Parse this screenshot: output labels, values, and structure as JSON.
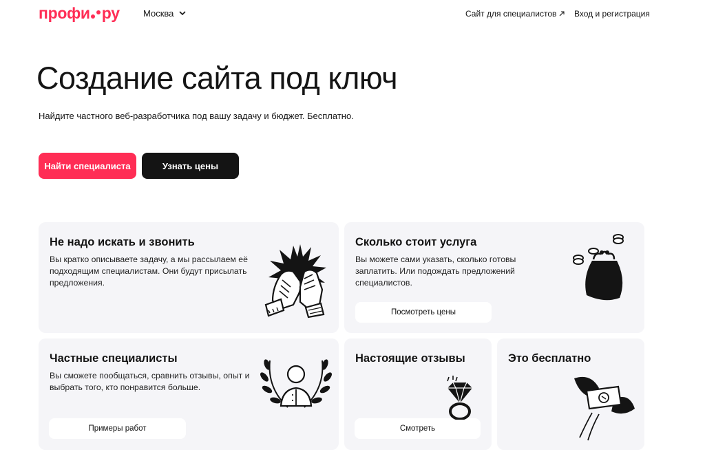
{
  "header": {
    "logo": {
      "left": "профи",
      "right": "ру"
    },
    "city": "Москва",
    "specialists_link": "Сайт для специалистов",
    "login": "Вход и регистрация"
  },
  "hero": {
    "title": "Создание сайта под ключ",
    "subtitle": "Найдите частного веб-разработчика под вашу задачу и бюджет. Бесплатно.",
    "primary_button": "Найти специалиста",
    "secondary_button": "Узнать цены"
  },
  "cards": {
    "search": {
      "title": "Не надо искать и звонить",
      "text": "Вы кратко описываете задачу, а мы рассылаем её подходящим специалистам. Они будут присылать предложения."
    },
    "price": {
      "title": "Сколько стоит услуга",
      "text": "Вы можете сами указать, сколько готовы заплатить. Или подождать предложений специалистов.",
      "button": "Посмотреть цены"
    },
    "private": {
      "title": "Частные специалисты",
      "text": "Вы сможете пообщаться, сравнить отзывы, опыт и выбрать того, кто понравится больше.",
      "button": "Примеры работ"
    },
    "reviews": {
      "title": "Настоящие отзывы",
      "button": "Смотреть"
    },
    "free": {
      "title": "Это бесплатно"
    }
  },
  "colors": {
    "brand": "#ff2d55",
    "dark": "#141414",
    "card_bg": "#f5f5f8"
  },
  "icons": [
    "chevron-down-icon",
    "external-arrow-icon",
    "high-five-icon",
    "wallet-coins-icon",
    "laurel-person-icon",
    "diamond-ring-icon",
    "flying-money-icon"
  ]
}
